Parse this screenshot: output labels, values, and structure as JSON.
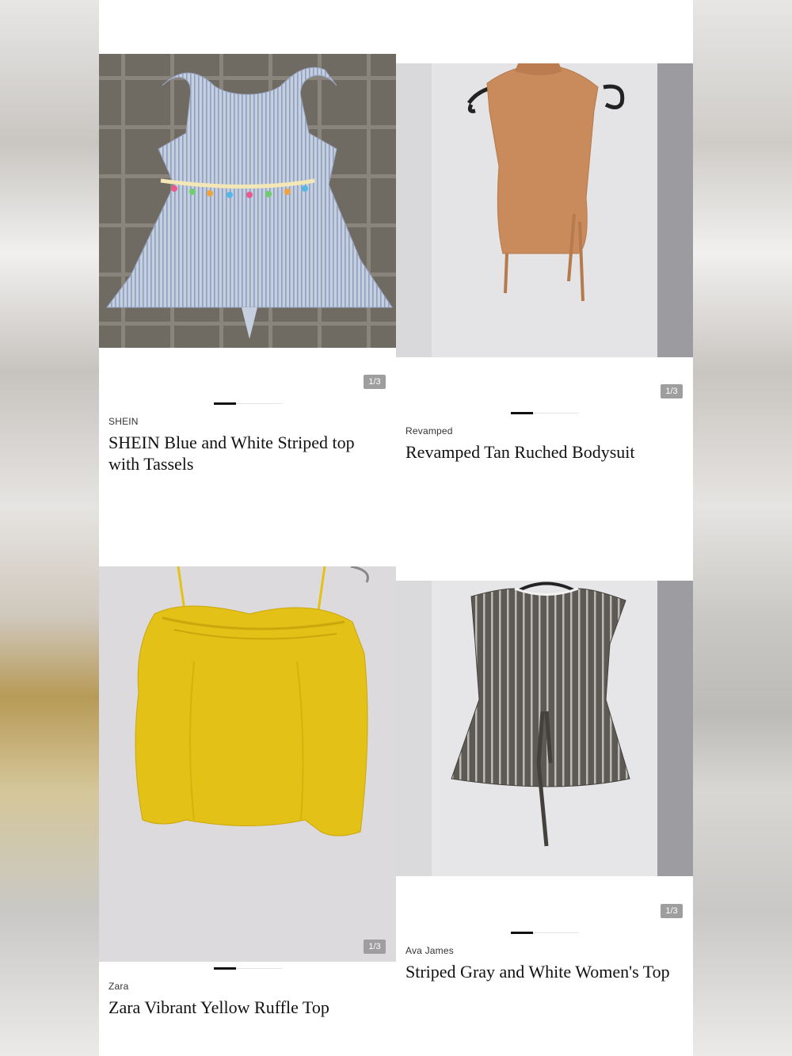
{
  "products": [
    {
      "brand": "SHEIN",
      "title": "SHEIN Blue and White Striped top with Tassels",
      "counter": "1/3",
      "photo_icon": "striped-blue-dress-photo",
      "colors": {
        "backdrop": "#6f6a62",
        "garment": "#b7c3d8"
      }
    },
    {
      "brand": "Revamped",
      "title": "Revamped Tan Ruched Bodysuit",
      "counter": "1/3",
      "photo_icon": "tan-bodysuit-on-hanger-photo",
      "colors": {
        "backdrop": "#e4e4e6",
        "garment": "#c98b5c"
      }
    },
    {
      "brand": "Zara",
      "title": "Zara Vibrant Yellow Ruffle Top",
      "counter": "1/3",
      "photo_icon": "yellow-ruffle-top-photo",
      "colors": {
        "backdrop": "#dcdadd",
        "garment": "#e3c116"
      }
    },
    {
      "brand": "Ava James",
      "title": "Striped Gray and White Women's Top",
      "counter": "1/3",
      "photo_icon": "gray-striped-top-on-hanger-photo",
      "colors": {
        "backdrop": "#e6e6e8",
        "garment": "#5d5a56"
      }
    }
  ]
}
